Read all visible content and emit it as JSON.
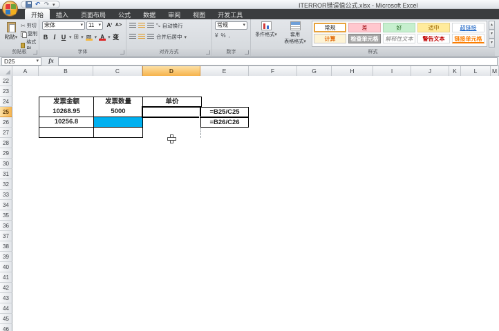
{
  "window": {
    "title": "ITERROR错误值公式.xlsx - Microsoft Excel"
  },
  "ribbon": {
    "tabs": [
      {
        "label": "开始",
        "active": true
      },
      {
        "label": "插入",
        "active": false
      },
      {
        "label": "页面布局",
        "active": false
      },
      {
        "label": "公式",
        "active": false
      },
      {
        "label": "数据",
        "active": false
      },
      {
        "label": "审阅",
        "active": false
      },
      {
        "label": "视图",
        "active": false
      },
      {
        "label": "开发工具",
        "active": false
      }
    ],
    "clipboard": {
      "paste": "粘贴",
      "cut": "剪切",
      "copy": "复制",
      "painter": "格式刷",
      "label": "剪贴板"
    },
    "font": {
      "name": "宋体",
      "size": "11",
      "bold": "B",
      "italic": "I",
      "underline": "U",
      "pinyin": "变",
      "label": "字体"
    },
    "alignment": {
      "wrap": "自动换行",
      "merge": "合并后居中",
      "label": "对齐方式"
    },
    "number": {
      "format": "常规",
      "currency": "¥",
      "percent": "%",
      "comma": ",",
      "label": "数字"
    },
    "styles": {
      "conditional": "条件格式",
      "format_table_line1": "套用",
      "format_table_line2": "表格格式",
      "label": "样式",
      "rows": [
        [
          {
            "label": "常规",
            "kind": "normal",
            "selected": true
          },
          {
            "label": "差",
            "kind": "bad",
            "selected": false
          },
          {
            "label": "好",
            "kind": "good",
            "selected": false
          },
          {
            "label": "适中",
            "kind": "neutral",
            "selected": false
          },
          {
            "label": "超链接",
            "kind": "hyperlink",
            "selected": false
          }
        ],
        [
          {
            "label": "计算",
            "kind": "calc",
            "selected": false
          },
          {
            "label": "检查单元格",
            "kind": "check",
            "selected": false
          },
          {
            "label": "解释性文本",
            "kind": "explain",
            "selected": false
          },
          {
            "label": "警告文本",
            "kind": "warning",
            "selected": false
          },
          {
            "label": "链接单元格",
            "kind": "linked",
            "selected": false
          }
        ]
      ]
    }
  },
  "formula_bar": {
    "name_box": "D25",
    "fx": "fx",
    "value": ""
  },
  "sheet": {
    "selected_column": "D",
    "selected_row": 25,
    "row_start": 22,
    "row_end": 46,
    "columns": [
      {
        "letter": "A",
        "width": 38
      },
      {
        "letter": "B",
        "width": 79
      },
      {
        "letter": "C",
        "width": 71
      },
      {
        "letter": "D",
        "width": 84
      },
      {
        "letter": "E",
        "width": 70
      },
      {
        "letter": "F",
        "width": 70
      },
      {
        "letter": "G",
        "width": 50
      },
      {
        "letter": "H",
        "width": 60
      },
      {
        "letter": "I",
        "width": 55
      },
      {
        "letter": "J",
        "width": 55
      },
      {
        "letter": "K",
        "width": 17
      },
      {
        "letter": "L",
        "width": 43
      },
      {
        "letter": "M",
        "width": 12
      }
    ],
    "table": {
      "headers": [
        "发票金额",
        "发票数量",
        "单价"
      ],
      "b25": "10268.95",
      "c25": "5000",
      "b26": "10256.8",
      "c26": "",
      "b27": "",
      "c27": "",
      "fill_color": "#00b0f0",
      "formulas": [
        "=B25/C25",
        "=B26/C26"
      ]
    }
  }
}
